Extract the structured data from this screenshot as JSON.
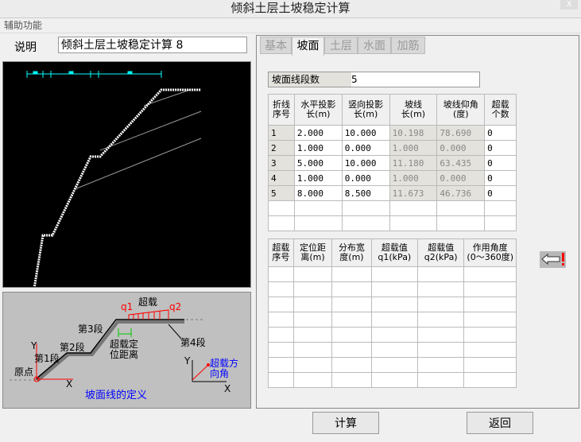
{
  "window": {
    "title": "倾斜土层土坡稳定计算",
    "close": "X"
  },
  "menu": {
    "aux": "辅助功能"
  },
  "description": {
    "label": "说明",
    "value": "倾斜土层土坡稳定计算 8"
  },
  "tabs": [
    {
      "label": "基本"
    },
    {
      "label": "坡面"
    },
    {
      "label": "土层"
    },
    {
      "label": "水面"
    },
    {
      "label": "加筋"
    }
  ],
  "segments": {
    "label": "坡面线段数",
    "value": "5"
  },
  "slope_table": {
    "headers": [
      "折线\n序号",
      "水平投影\n长(m)",
      "竖向投影\n长(m)",
      "坡线\n长(m)",
      "坡线仰角\n(度)",
      "超载\n个数"
    ],
    "rows": [
      [
        "1",
        "2.000",
        "10.000",
        "10.198",
        "78.690",
        "0"
      ],
      [
        "2",
        "1.000",
        "0.000",
        "1.000",
        "0.000",
        "0"
      ],
      [
        "3",
        "5.000",
        "10.000",
        "11.180",
        "63.435",
        "0"
      ],
      [
        "4",
        "1.000",
        "0.000",
        "1.000",
        "0.000",
        "0"
      ],
      [
        "5",
        "8.000",
        "8.500",
        "11.673",
        "46.736",
        "0"
      ]
    ]
  },
  "load_table": {
    "headers": [
      "超载\n序号",
      "定位距\n离(m)",
      "分布宽\n度(m)",
      "超载值\nq1(kPa)",
      "超载值\nq2(kPa)",
      "作用角度\n(0～360度)"
    ]
  },
  "diagram": {
    "overload": "超载",
    "q1": "q1",
    "q2": "q2",
    "seg1": "第1段",
    "seg2": "第2段",
    "seg3": "第3段",
    "seg4": "第4段",
    "origin": "原点",
    "y": "Y",
    "x": "X",
    "locate": "超载定\n位距离",
    "dir": "超载方\n向角",
    "caption": "坡面线的定义"
  },
  "buttons": {
    "calc": "计算",
    "back": "返回"
  }
}
